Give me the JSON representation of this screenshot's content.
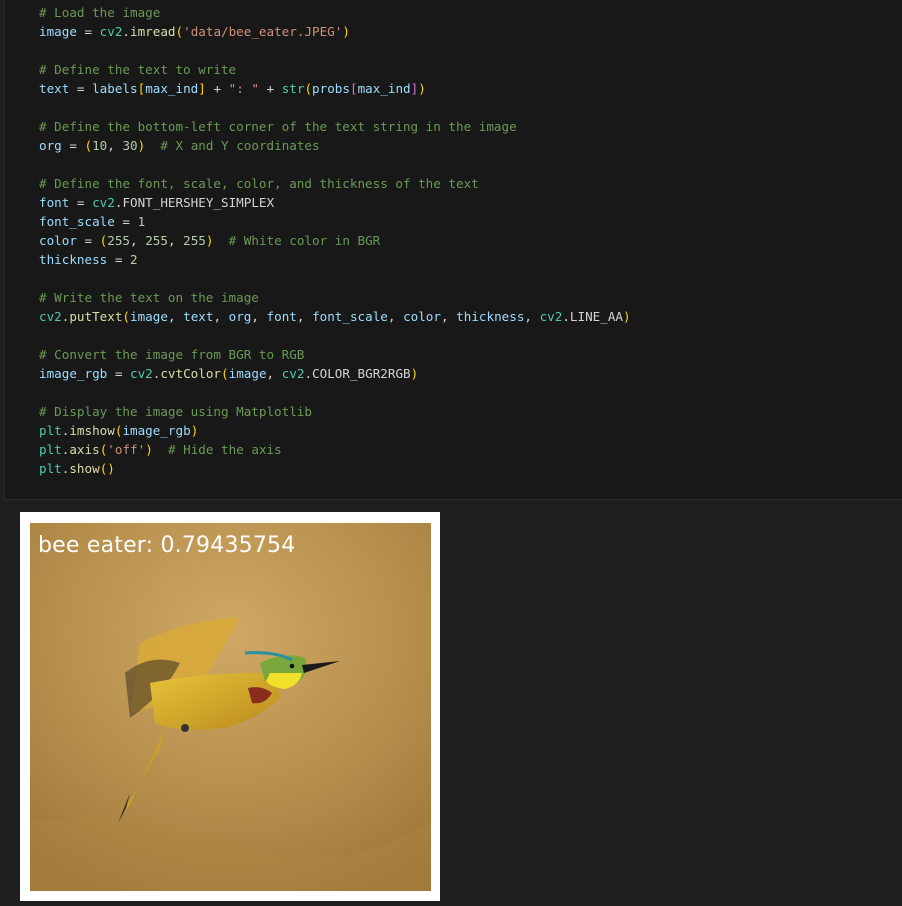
{
  "code": {
    "lines": [
      [
        {
          "t": "# Load the image",
          "c": "cm"
        }
      ],
      [
        {
          "t": "image",
          "c": "va"
        },
        {
          "t": " = ",
          "c": "op"
        },
        {
          "t": "cv2",
          "c": "mo"
        },
        {
          "t": ".",
          "c": "pn"
        },
        {
          "t": "imread",
          "c": "fn"
        },
        {
          "t": "(",
          "c": "b1"
        },
        {
          "t": "'data/bee_eater.JPEG'",
          "c": "st"
        },
        {
          "t": ")",
          "c": "b1"
        }
      ],
      [],
      [
        {
          "t": "# Define the text to write",
          "c": "cm"
        }
      ],
      [
        {
          "t": "text",
          "c": "va"
        },
        {
          "t": " = ",
          "c": "op"
        },
        {
          "t": "labels",
          "c": "va"
        },
        {
          "t": "[",
          "c": "b1"
        },
        {
          "t": "max_ind",
          "c": "va"
        },
        {
          "t": "]",
          "c": "b1"
        },
        {
          "t": " + ",
          "c": "op"
        },
        {
          "t": "\": \"",
          "c": "st"
        },
        {
          "t": " + ",
          "c": "op"
        },
        {
          "t": "str",
          "c": "mo"
        },
        {
          "t": "(",
          "c": "b1"
        },
        {
          "t": "probs",
          "c": "va"
        },
        {
          "t": "[",
          "c": "b2"
        },
        {
          "t": "max_ind",
          "c": "va"
        },
        {
          "t": "]",
          "c": "b2"
        },
        {
          "t": ")",
          "c": "b1"
        }
      ],
      [],
      [
        {
          "t": "# Define the bottom-left corner of the text string in the image",
          "c": "cm"
        }
      ],
      [
        {
          "t": "org",
          "c": "va"
        },
        {
          "t": " = ",
          "c": "op"
        },
        {
          "t": "(",
          "c": "b1"
        },
        {
          "t": "10",
          "c": "nu"
        },
        {
          "t": ", ",
          "c": "pn"
        },
        {
          "t": "30",
          "c": "nu"
        },
        {
          "t": ")",
          "c": "b1"
        },
        {
          "t": "  ",
          "c": "pn"
        },
        {
          "t": "# X and Y coordinates",
          "c": "cm"
        }
      ],
      [],
      [
        {
          "t": "# Define the font, scale, color, and thickness of the text",
          "c": "cm"
        }
      ],
      [
        {
          "t": "font",
          "c": "va"
        },
        {
          "t": " = ",
          "c": "op"
        },
        {
          "t": "cv2",
          "c": "mo"
        },
        {
          "t": ".",
          "c": "pn"
        },
        {
          "t": "FONT_HERSHEY_SIMPLEX",
          "c": "pn"
        }
      ],
      [
        {
          "t": "font_scale",
          "c": "va"
        },
        {
          "t": " = ",
          "c": "op"
        },
        {
          "t": "1",
          "c": "nu"
        }
      ],
      [
        {
          "t": "color",
          "c": "va"
        },
        {
          "t": " = ",
          "c": "op"
        },
        {
          "t": "(",
          "c": "b1"
        },
        {
          "t": "255",
          "c": "nu"
        },
        {
          "t": ", ",
          "c": "pn"
        },
        {
          "t": "255",
          "c": "nu"
        },
        {
          "t": ", ",
          "c": "pn"
        },
        {
          "t": "255",
          "c": "nu"
        },
        {
          "t": ")",
          "c": "b1"
        },
        {
          "t": "  ",
          "c": "pn"
        },
        {
          "t": "# White color in BGR",
          "c": "cm"
        }
      ],
      [
        {
          "t": "thickness",
          "c": "va"
        },
        {
          "t": " = ",
          "c": "op"
        },
        {
          "t": "2",
          "c": "nu"
        }
      ],
      [],
      [
        {
          "t": "# Write the text on the image",
          "c": "cm"
        }
      ],
      [
        {
          "t": "cv2",
          "c": "mo"
        },
        {
          "t": ".",
          "c": "pn"
        },
        {
          "t": "putText",
          "c": "fn"
        },
        {
          "t": "(",
          "c": "b1"
        },
        {
          "t": "image",
          "c": "va"
        },
        {
          "t": ", ",
          "c": "pn"
        },
        {
          "t": "text",
          "c": "va"
        },
        {
          "t": ", ",
          "c": "pn"
        },
        {
          "t": "org",
          "c": "va"
        },
        {
          "t": ", ",
          "c": "pn"
        },
        {
          "t": "font",
          "c": "va"
        },
        {
          "t": ", ",
          "c": "pn"
        },
        {
          "t": "font_scale",
          "c": "va"
        },
        {
          "t": ", ",
          "c": "pn"
        },
        {
          "t": "color",
          "c": "va"
        },
        {
          "t": ", ",
          "c": "pn"
        },
        {
          "t": "thickness",
          "c": "va"
        },
        {
          "t": ", ",
          "c": "pn"
        },
        {
          "t": "cv2",
          "c": "mo"
        },
        {
          "t": ".",
          "c": "pn"
        },
        {
          "t": "LINE_AA",
          "c": "pn"
        },
        {
          "t": ")",
          "c": "b1"
        }
      ],
      [],
      [
        {
          "t": "# Convert the image from BGR to RGB",
          "c": "cm"
        }
      ],
      [
        {
          "t": "image_rgb",
          "c": "va"
        },
        {
          "t": " = ",
          "c": "op"
        },
        {
          "t": "cv2",
          "c": "mo"
        },
        {
          "t": ".",
          "c": "pn"
        },
        {
          "t": "cvtColor",
          "c": "fn"
        },
        {
          "t": "(",
          "c": "b1"
        },
        {
          "t": "image",
          "c": "va"
        },
        {
          "t": ", ",
          "c": "pn"
        },
        {
          "t": "cv2",
          "c": "mo"
        },
        {
          "t": ".",
          "c": "pn"
        },
        {
          "t": "COLOR_BGR2RGB",
          "c": "pn"
        },
        {
          "t": ")",
          "c": "b1"
        }
      ],
      [],
      [
        {
          "t": "# Display the image using Matplotlib",
          "c": "cm"
        }
      ],
      [
        {
          "t": "plt",
          "c": "mo"
        },
        {
          "t": ".",
          "c": "pn"
        },
        {
          "t": "imshow",
          "c": "fn"
        },
        {
          "t": "(",
          "c": "b1"
        },
        {
          "t": "image_rgb",
          "c": "va"
        },
        {
          "t": ")",
          "c": "b1"
        }
      ],
      [
        {
          "t": "plt",
          "c": "mo"
        },
        {
          "t": ".",
          "c": "pn"
        },
        {
          "t": "axis",
          "c": "fn"
        },
        {
          "t": "(",
          "c": "b1"
        },
        {
          "t": "'off'",
          "c": "st"
        },
        {
          "t": ")",
          "c": "b1"
        },
        {
          "t": "  ",
          "c": "pn"
        },
        {
          "t": "# Hide the axis",
          "c": "cm"
        }
      ],
      [
        {
          "t": "plt",
          "c": "mo"
        },
        {
          "t": ".",
          "c": "pn"
        },
        {
          "t": "show",
          "c": "fn"
        },
        {
          "t": "()",
          "c": "b1"
        }
      ]
    ]
  },
  "output": {
    "image_caption": "bee eater: 0.79435754",
    "image_subject": "bee-eater-bird-photo"
  },
  "colors": {
    "editor_background": "#181818",
    "page_background": "#1f1f1f",
    "comment": "#6a9955",
    "variable": "#9cdcfe",
    "function": "#dcdcaa",
    "string": "#ce9178",
    "number": "#b5cea8",
    "bracket": "#ffd700"
  }
}
